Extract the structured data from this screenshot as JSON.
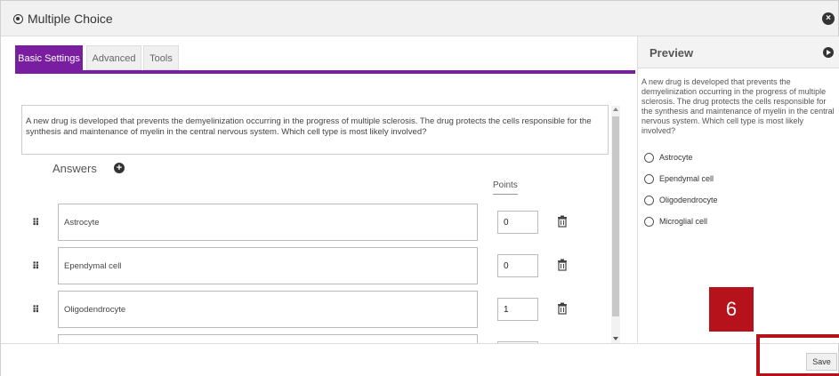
{
  "dialog": {
    "title": "Multiple Choice",
    "icons": {
      "title": "radio-icon",
      "close": "close-icon"
    }
  },
  "tabs": [
    {
      "label": "Basic Settings",
      "active": true
    },
    {
      "label": "Advanced",
      "active": false
    },
    {
      "label": "Tools",
      "active": false
    }
  ],
  "editor": {
    "question": "A new drug is developed that prevents the demyelinization occurring in the progress of multiple sclerosis. The drug protects the cells responsible for the synthesis and maintenance of myelin in the central nervous system. Which cell type is most likely involved?",
    "answers_label": "Answers",
    "points_label": "Points",
    "answers": [
      {
        "text": "Astrocyte",
        "points": "0"
      },
      {
        "text": "Ependymal cell",
        "points": "0"
      },
      {
        "text": "Oligodendrocyte",
        "points": "1"
      }
    ]
  },
  "preview": {
    "title": "Preview",
    "question": "A new drug is developed that prevents the demyelinization occurring in the progress of multiple sclerosis. The drug protects the cells responsible for the synthesis and maintenance of myelin in the central nervous system. Which cell type is most likely involved?",
    "options": [
      "Astrocyte",
      "Ependymal cell",
      "Oligodendrocyte",
      "Microglial cell"
    ]
  },
  "footer": {
    "save_label": "Save"
  },
  "callout": {
    "number": "6",
    "color": "#b5121b"
  },
  "colors": {
    "accent": "#7a1ea1"
  }
}
